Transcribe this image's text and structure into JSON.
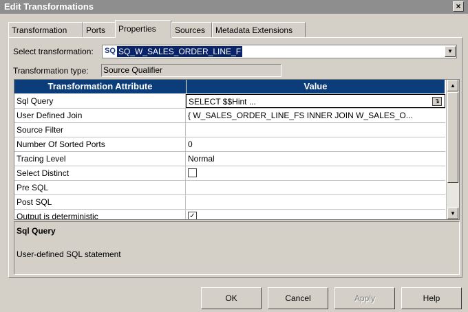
{
  "window": {
    "title": "Edit Transformations",
    "close_glyph": "×"
  },
  "tabs": [
    {
      "label": "Transformation"
    },
    {
      "label": "Ports"
    },
    {
      "label": "Properties"
    },
    {
      "label": "Sources"
    },
    {
      "label": "Metadata Extensions"
    }
  ],
  "selected_tab": "Properties",
  "select_transformation": {
    "label": "Select transformation:",
    "icon_text": "SQ",
    "value": "SQ_W_SALES_ORDER_LINE_F"
  },
  "transformation_type": {
    "label": "Transformation type:",
    "value": "Source Qualifier"
  },
  "grid": {
    "headers": [
      "Transformation Attribute",
      "Value"
    ],
    "rows": [
      {
        "attribute": "Sql Query",
        "value": "SELECT  $$Hint ...",
        "selected": true,
        "has_edit_button": true
      },
      {
        "attribute": "User Defined Join",
        "value": "{ W_SALES_ORDER_LINE_FS INNER JOIN W_SALES_O..."
      },
      {
        "attribute": "Source Filter",
        "value": ""
      },
      {
        "attribute": "Number Of Sorted Ports",
        "value": "0"
      },
      {
        "attribute": "Tracing Level",
        "value": "Normal"
      },
      {
        "attribute": "Select Distinct",
        "checkbox": false
      },
      {
        "attribute": "Pre SQL",
        "value": ""
      },
      {
        "attribute": "Post SQL",
        "value": ""
      },
      {
        "attribute": "Output is deterministic",
        "checkbox": true
      }
    ]
  },
  "description": {
    "title": "Sql Query",
    "text": "User-defined SQL statement"
  },
  "buttons": {
    "ok": "OK",
    "cancel": "Cancel",
    "apply": "Apply",
    "help": "Help"
  },
  "colors": {
    "header_bg": "#0a3d7a",
    "selection_bg": "#0a246a",
    "dialog_bg": "#d4d0c8"
  }
}
